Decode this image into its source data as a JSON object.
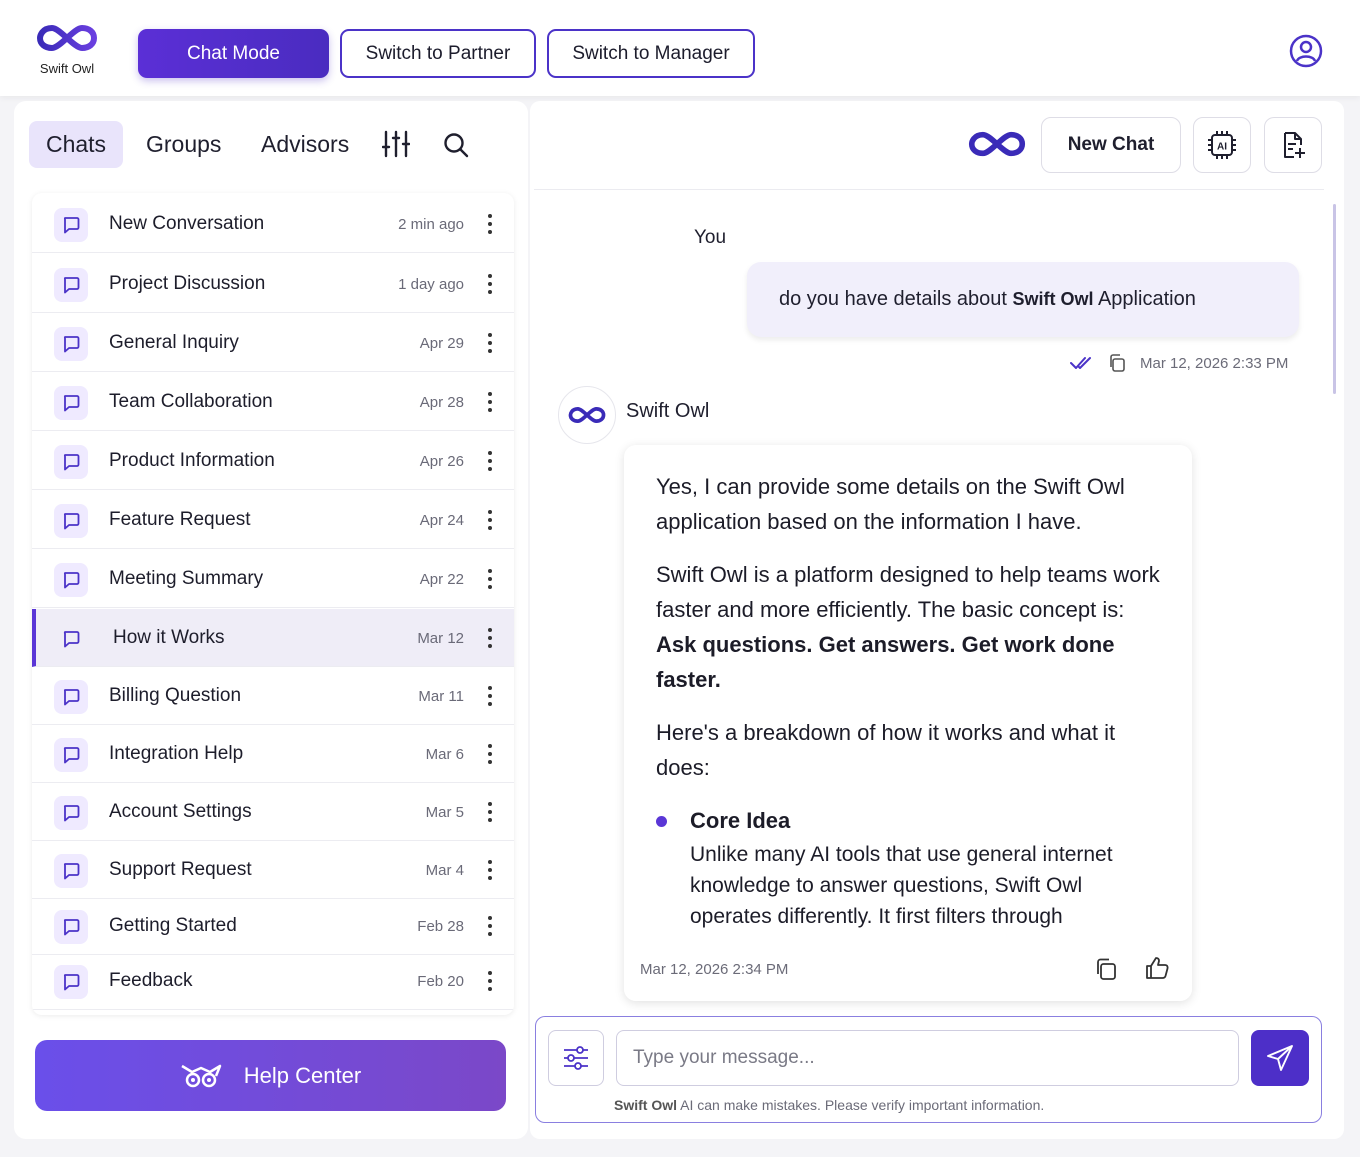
{
  "brand": {
    "name": "Swift Owl"
  },
  "modes": {
    "chat": "Chat Mode",
    "partner": "Switch to Partner",
    "manager": "Switch to Manager"
  },
  "tabs": {
    "chats": "Chats",
    "groups": "Groups",
    "advisors": "Advisors"
  },
  "chats": [
    {
      "title": "New Conversation",
      "date": "2 min ago"
    },
    {
      "title": "Project Discussion",
      "date": "1 day ago"
    },
    {
      "title": "General Inquiry",
      "date": "Apr 29"
    },
    {
      "title": "Team Collaboration",
      "date": "Apr 28"
    },
    {
      "title": "Product Information",
      "date": "Apr 26"
    },
    {
      "title": "Feature Request",
      "date": "Apr 24"
    },
    {
      "title": "Meeting Summary",
      "date": "Apr 22"
    },
    {
      "title": "How it Works",
      "date": "Mar 12",
      "active": true
    },
    {
      "title": "Billing Question",
      "date": "Mar 11"
    },
    {
      "title": "Integration Help",
      "date": "Mar 6"
    },
    {
      "title": "Account Settings",
      "date": "Mar 5"
    },
    {
      "title": "Support Request",
      "date": "Mar 4"
    },
    {
      "title": "Getting Started",
      "date": "Feb 28"
    },
    {
      "title": "Feedback",
      "date": "Feb 20"
    }
  ],
  "help_center": "Help Center",
  "header": {
    "new_chat": "New Chat",
    "ai_label": "AI"
  },
  "user_message": {
    "sender": "You",
    "text_before": "do you have details about ",
    "text_bold": "Swift Owl",
    "text_after": " Application",
    "timestamp": "Mar 12, 2026 2:33 PM"
  },
  "bot_message": {
    "sender": "Swift Owl",
    "p1": "Yes, I can provide some details on the Swift Owl application based on the information I have.",
    "p2_text": "Swift Owl is a platform designed to help teams work faster and more efficiently. The basic concept is: ",
    "p2_bold": "Ask questions. Get answers. Get work done faster.",
    "p3": "Here's a breakdown of how it works and what it does:",
    "bullet_title": "Core Idea",
    "bullet_text": "Unlike many AI tools that use general internet knowledge to answer questions, Swift Owl operates differently. It first filters through",
    "timestamp": "Mar 12, 2026 2:34 PM"
  },
  "composer": {
    "placeholder": "Type your message...",
    "disclaimer_brand": "Swift Owl",
    "disclaimer_text": " AI can make mistakes. Please verify important information."
  },
  "colors": {
    "accent": "#5a36d6",
    "accent_light": "#efeaff"
  }
}
